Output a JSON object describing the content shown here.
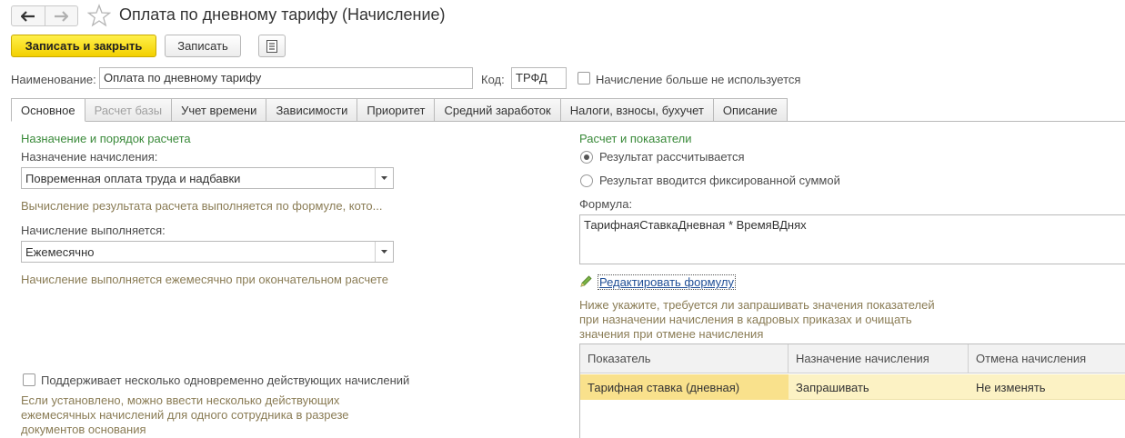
{
  "window": {
    "title": "Оплата по дневному тарифу (Начисление)"
  },
  "toolbar": {
    "save_close_label": "Записать и закрыть",
    "save_label": "Записать"
  },
  "header": {
    "name_label": "Наименование:",
    "name_value": "Оплата по дневному тарифу",
    "code_label": "Код:",
    "code_value": "ТРФД",
    "unused_label": "Начисление больше не используется"
  },
  "tabs": [
    {
      "label": "Основное",
      "active": true
    },
    {
      "label": "Расчет базы",
      "disabled": true
    },
    {
      "label": "Учет времени"
    },
    {
      "label": "Зависимости"
    },
    {
      "label": "Приоритет"
    },
    {
      "label": "Средний заработок"
    },
    {
      "label": "Налоги, взносы, бухучет"
    },
    {
      "label": "Описание"
    }
  ],
  "left": {
    "section_title": "Назначение и порядок расчета",
    "purpose_label": "Назначение начисления:",
    "purpose_value": "Повременная оплата труда и надбавки",
    "purpose_hint": "Вычисление результата расчета выполняется по формуле, кото...",
    "period_label": "Начисление выполняется:",
    "period_value": "Ежемесячно",
    "period_hint": "Начисление выполняется ежемесячно при окончательном расчете",
    "multi_label": "Поддерживает несколько одновременно действующих начислений",
    "multi_hint_1": "Если установлено, можно ввести несколько действующих",
    "multi_hint_2": "ежемесячных начислений для одного сотрудника в разрезе",
    "multi_hint_3": "документов основания"
  },
  "right": {
    "section_title": "Расчет и показатели",
    "radio_calc": "Результат рассчитывается",
    "radio_fixed": "Результат вводится фиксированной суммой",
    "formula_label": "Формула:",
    "formula_value": "ТарифнаяСтавкаДневная * ВремяВДнях",
    "edit_formula_link": "Редактировать формулу",
    "ind_hint_1": "Ниже укажите, требуется ли запрашивать значения показателей",
    "ind_hint_2": "при назначении начисления в кадровых приказах и очищать",
    "ind_hint_3": "значения при отмене начисления",
    "table": {
      "columns": [
        "Показатель",
        "Назначение начисления",
        "Отмена начисления"
      ],
      "rows": [
        [
          "Тарифная ставка (дневная)",
          "Запрашивать",
          "Не изменять"
        ]
      ]
    }
  },
  "colors": {
    "accent_yellow": "#f7d600",
    "section_green": "#3a8a3a",
    "hint": "#8a7c55",
    "selected_row": "#fcf2c4"
  }
}
